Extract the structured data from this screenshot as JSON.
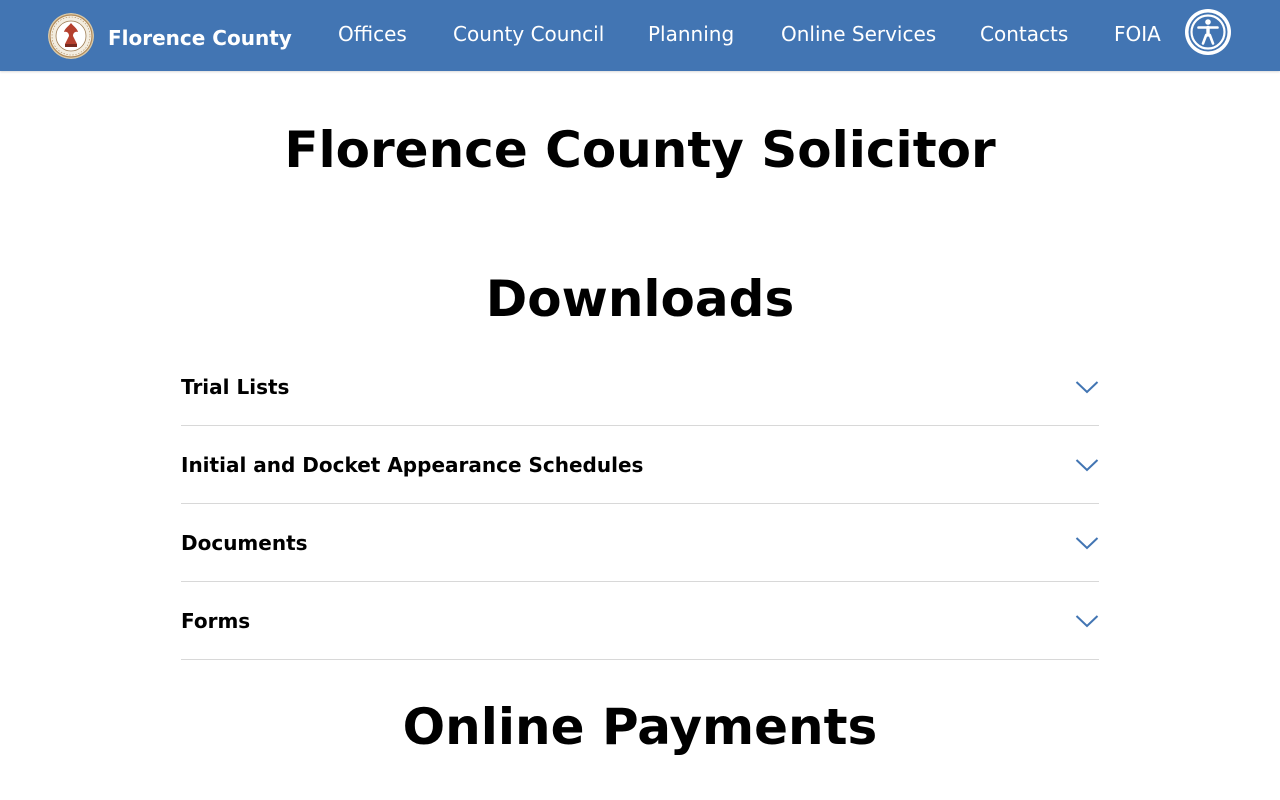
{
  "header": {
    "brand_name": "Florence County",
    "nav": [
      "Offices",
      "County Council",
      "Planning",
      "Online Services",
      "Contacts",
      "FOIA"
    ],
    "seal_icon": "county-seal-icon",
    "accessibility_icon": "accessibility-icon",
    "bar_color": "#4275b3"
  },
  "main": {
    "title": "Florence County Solicitor",
    "downloads": {
      "heading": "Downloads",
      "items": [
        "Trial Lists",
        "Initial and Docket Appearance Schedules",
        "Documents",
        "Forms"
      ],
      "expand_icon": "chevron-down-icon",
      "chevron_color": "#4275b3"
    },
    "payments": {
      "heading": "Online Payments"
    }
  }
}
